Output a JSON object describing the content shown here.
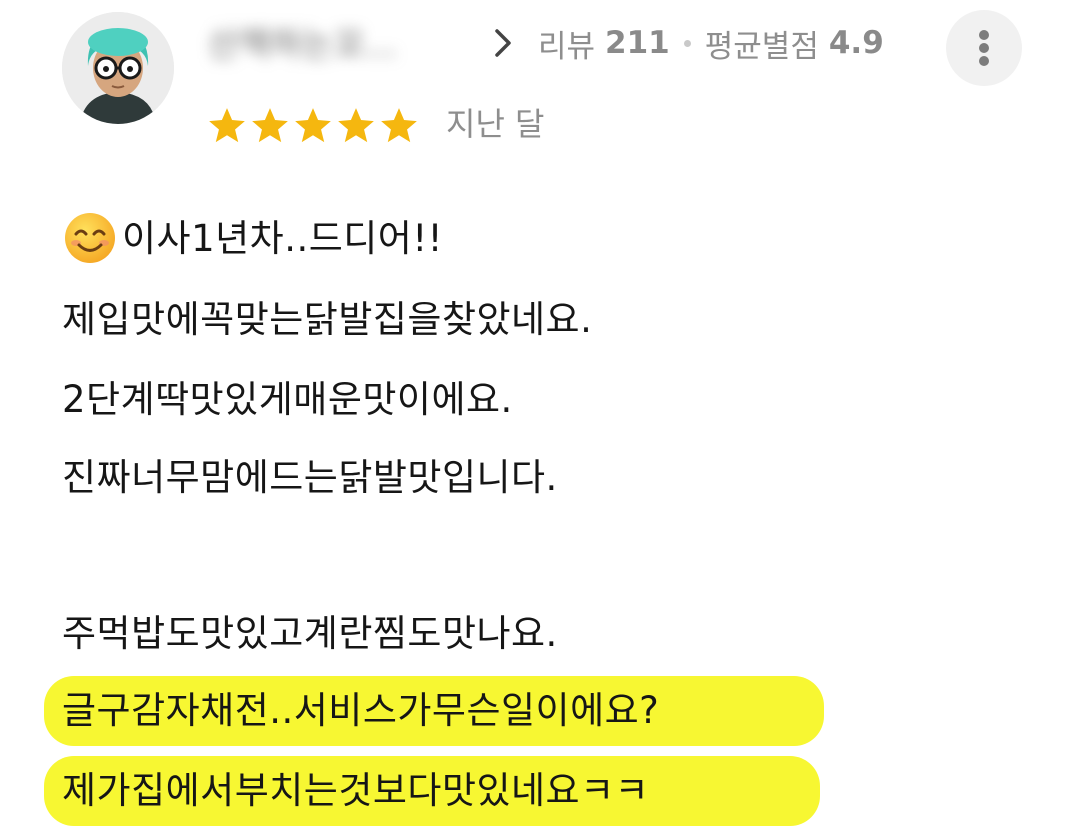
{
  "review_header": {
    "username": "산책하는꼬...",
    "review_label": "리뷰",
    "review_count": "211",
    "rating_label": "평균별점",
    "rating_avg": "4.9",
    "star_count": 5,
    "date": "지난 달",
    "star_color": "#F5B70F"
  },
  "review": {
    "lines": [
      "이사1년차..드디어!!",
      "제입맛에꼭맞는닭발집을찾았네요.",
      "2단계딱맛있게매운맛이에요.",
      "진짜너무맘에드는닭발맛입니다.",
      "",
      "주먹밥도맛있고계란찜도맛나요.",
      "글구감자채전..서비스가무슨일이에요?",
      "제가집에서부치는것보다맛있네요ㅋㅋ"
    ],
    "highlight_color": "#F7F732"
  }
}
